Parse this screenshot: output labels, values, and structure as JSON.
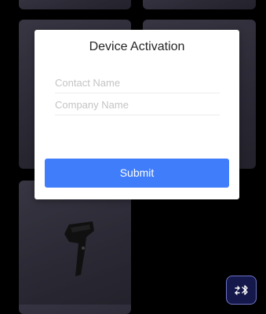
{
  "dialog": {
    "title": "Device Activation",
    "contact_placeholder": "Contact Name",
    "company_placeholder": "Company Name",
    "submit_label": "Submit"
  },
  "bluetooth_button": {
    "icon": "bluetooth-transfer-icon"
  },
  "colors": {
    "primary": "#3f7dfa",
    "background": "#000000",
    "tile": "#3a3847",
    "bluetooth_button_bg": "#15184a"
  }
}
